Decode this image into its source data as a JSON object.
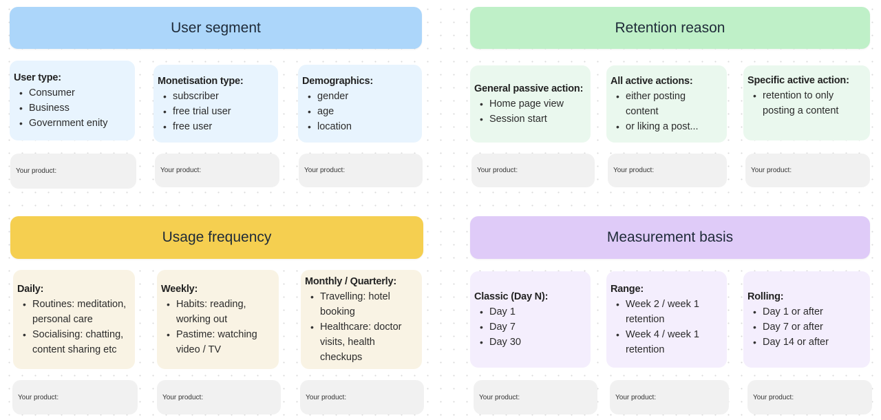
{
  "colors": {
    "user_segment_header": "#acd6fa",
    "user_segment_card": "#e8f4fe",
    "retention_header": "#bff0c8",
    "retention_card": "#eaf8ee",
    "usage_header": "#f5cf50",
    "usage_card": "#f9f3e4",
    "measurement_header": "#dfcbf8",
    "measurement_card": "#f4eefd",
    "product_box": "#f1f1f1"
  },
  "sections": {
    "user_segment": {
      "title": "User segment",
      "cards": [
        {
          "title": "User type:",
          "items": [
            "Consumer",
            "Business",
            "Government enity"
          ],
          "product_label": "Your product:"
        },
        {
          "title": "Monetisation type:",
          "items": [
            "subscriber",
            "free trial user",
            "free user"
          ],
          "product_label": "Your product:"
        },
        {
          "title": "Demographics:",
          "items": [
            "gender",
            "age",
            "location"
          ],
          "product_label": "Your product:"
        }
      ]
    },
    "retention_reason": {
      "title": "Retention reason",
      "cards": [
        {
          "title": "General passive action:",
          "items": [
            "Home page view",
            "Session start"
          ],
          "product_label": "Your product:"
        },
        {
          "title": "All active actions:",
          "items": [
            "either posting content",
            "or liking a post..."
          ],
          "product_label": "Your product:"
        },
        {
          "title": "Specific active action:",
          "items": [
            "retention to only posting a content"
          ],
          "product_label": "Your product:"
        }
      ]
    },
    "usage_frequency": {
      "title": "Usage frequency",
      "cards": [
        {
          "title": "Daily:",
          "items": [
            "Routines: meditation, personal care",
            "Socialising: chatting, content sharing etc"
          ],
          "product_label": "Your product:"
        },
        {
          "title": "Weekly:",
          "items": [
            "Habits: reading, working out",
            "Pastime: watching video / TV"
          ],
          "product_label": "Your product:"
        },
        {
          "title": "Monthly / Quarterly:",
          "items": [
            "Travelling: hotel booking",
            "Healthcare: doctor visits, health checkups"
          ],
          "product_label": "Your product:"
        }
      ]
    },
    "measurement_basis": {
      "title": "Measurement basis",
      "cards": [
        {
          "title": "Classic (Day N):",
          "items": [
            "Day 1",
            "Day 7",
            "Day 30"
          ],
          "product_label": "Your product:"
        },
        {
          "title": "Range:",
          "items": [
            "Week 2 / week 1 retention",
            "Week 4  / week 1 retention"
          ],
          "product_label": "Your product:"
        },
        {
          "title": "Rolling:",
          "items": [
            "Day 1 or after",
            "Day 7 or after",
            "Day 14 or after"
          ],
          "product_label": "Your product:"
        }
      ]
    }
  }
}
